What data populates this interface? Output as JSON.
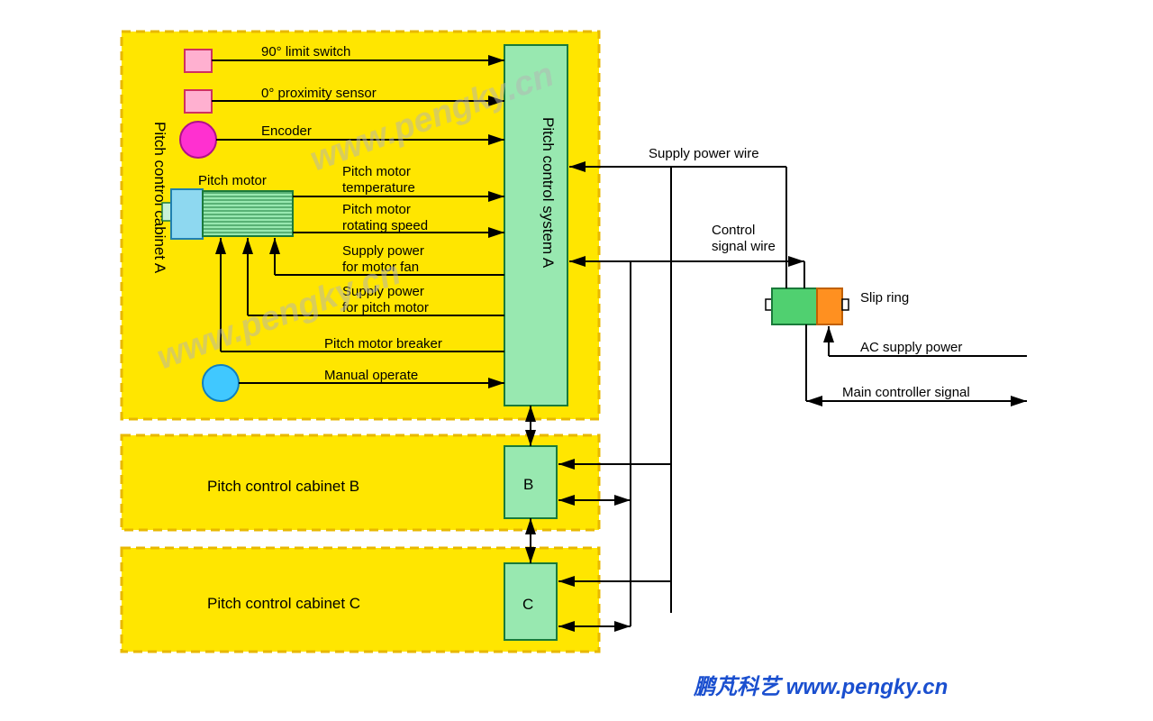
{
  "cabinets": {
    "a_label": "Pitch control cabinet A",
    "b_label": "Pitch control cabinet B",
    "c_label": "Pitch control cabinet C"
  },
  "system": {
    "a_label": "Pitch control system A",
    "b_label": "B",
    "c_label": "C"
  },
  "signals": {
    "limit_switch": "90° limit switch",
    "proximity": "0° proximity sensor",
    "encoder": "Encoder",
    "motor_label": "Pitch motor",
    "motor_temp1": "Pitch motor",
    "motor_temp2": "temperature",
    "motor_speed1": "Pitch motor",
    "motor_speed2": "rotating speed",
    "fan_power1": "Supply power",
    "fan_power2": "for motor fan",
    "pitch_power1": "Supply power",
    "pitch_power2": "for pitch motor",
    "breaker": "Pitch motor breaker",
    "manual": "Manual operate"
  },
  "external": {
    "supply_power": "Supply power wire",
    "control_signal1": "Control",
    "control_signal2": "signal wire",
    "slip_ring": "Slip ring",
    "ac_power": "AC supply power",
    "main_signal": "Main controller signal"
  },
  "footer": "鹏芃科艺 www.pengky.cn",
  "watermark": "www.pengky.cn"
}
